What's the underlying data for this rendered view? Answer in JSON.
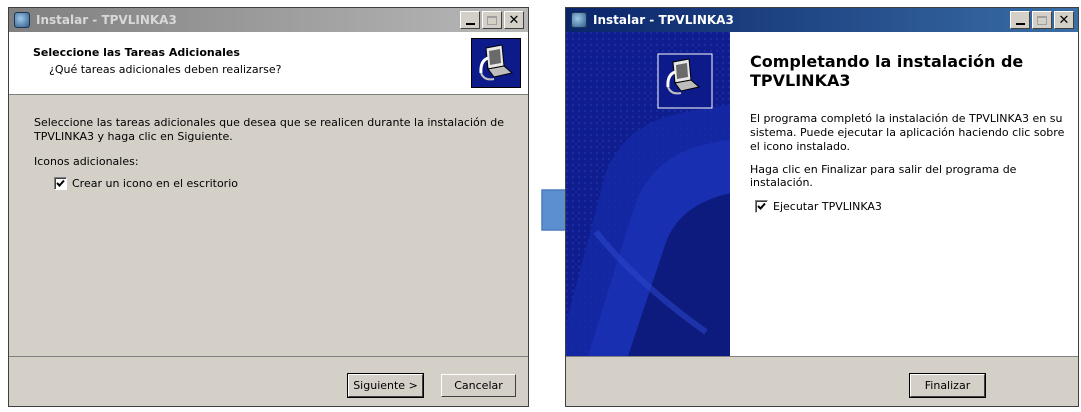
{
  "left_window": {
    "title": "Instalar - TPVLINKA3",
    "header_title": "Seleccione las Tareas Adicionales",
    "header_subtitle": "¿Qué tareas adicionales deben realizarse?",
    "description": "Seleccione las tareas adicionales que desea que se realicen durante la instalación de TPVLINKA3 y haga clic en Siguiente.",
    "group_label": "Iconos adicionales:",
    "checkbox_label": "Crear un icono en el escritorio",
    "checkbox_checked": true,
    "next_button": "Siguiente >",
    "cancel_button": "Cancelar"
  },
  "right_window": {
    "title": "Instalar - TPVLINKA3",
    "heading": "Completando la instalación de TPVLINKA3",
    "paragraph1": "El programa completó la instalación de TPVLINKA3 en su sistema. Puede ejecutar la aplicación haciendo clic sobre el icono instalado.",
    "paragraph2": "Haga clic en Finalizar para salir del programa de instalación.",
    "checkbox_label": "Ejecutar TPVLINKA3",
    "checkbox_checked": true,
    "finish_button": "Finalizar"
  },
  "colors": {
    "arrow": "#5b8fcf",
    "wizard_blue": "#0f1d8f",
    "active_title": "#0a246a"
  }
}
